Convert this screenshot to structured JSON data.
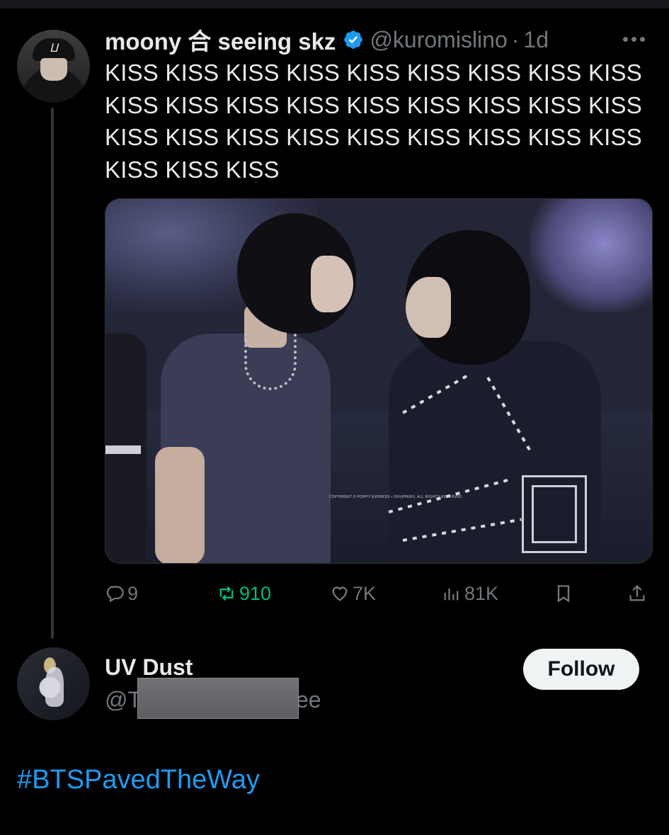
{
  "tweet": {
    "author_name": "moony 合 seeing skz",
    "handle": "@kuromislino",
    "separator": "·",
    "time": "1d",
    "text": "KISS KISS KISS KISS KISS KISS KISS KISS KISS KISS KISS KISS KISS KISS KISS KISS KISS KISS KISS KISS KISS KISS KISS KISS KISS KISS KISS KISS KISS KISS",
    "media_watermark": "COPYRIGHT © POPPY EXPRESS • OFUPPERS. ALL RIGHTS RESERVED.",
    "actions": {
      "replies": "9",
      "retweets": "910",
      "likes": "7K",
      "views": "81K"
    }
  },
  "follow_card": {
    "name": "UV Dust",
    "handle_start": "@T",
    "handle_end": "ee",
    "follow_label": "Follow"
  },
  "hashtag": "#BTSPavedTheWay",
  "colors": {
    "background": "#000000",
    "text": "#e7e9ea",
    "muted": "#71767b",
    "retweet_green": "#00ba7c",
    "link_blue": "#1d9bf0",
    "verified_blue": "#1d9bf0"
  }
}
